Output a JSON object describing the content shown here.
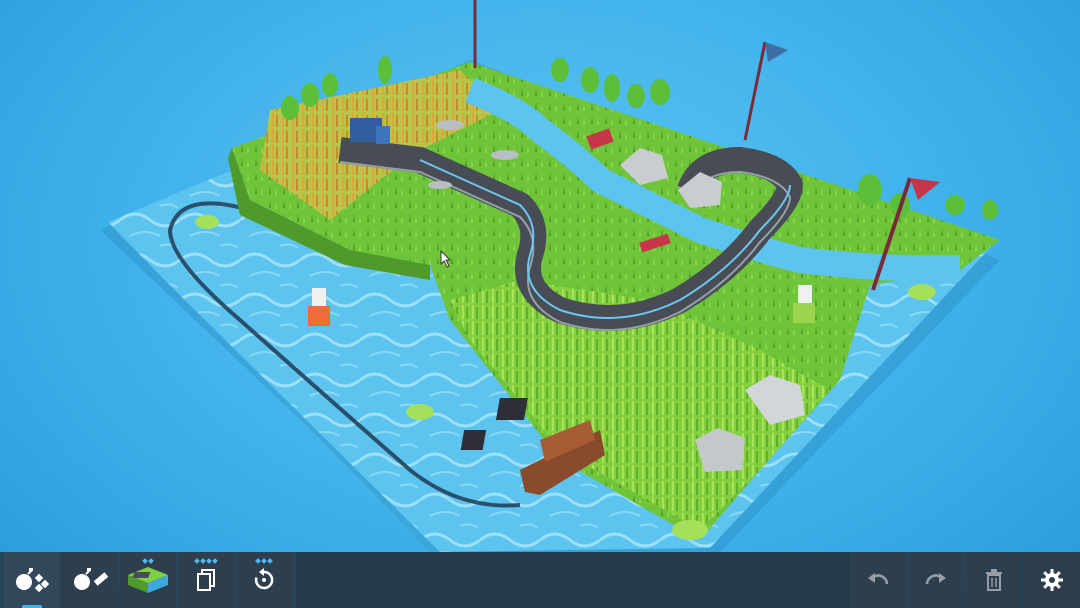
{
  "scene": {
    "description_icons": [
      "boat-icon",
      "truck-icon",
      "car-icon",
      "buoy-icon",
      "flag-icon"
    ],
    "colors": {
      "water": "#5cc3ee",
      "grass": "#7ccf3c",
      "road": "#474c55",
      "flag": "#c8344a",
      "boat_hull": "#8a4a2c"
    }
  },
  "toolbar": {
    "left_buttons": [
      {
        "icon": "bomb-tiles-icon",
        "active": true,
        "dots": 0
      },
      {
        "icon": "bomb-road-icon",
        "active": false,
        "dots": 0
      },
      {
        "icon": "terrain-block-icon",
        "active": false,
        "dots": 2
      },
      {
        "icon": "copy-icon",
        "active": false,
        "dots": 4
      },
      {
        "icon": "rotate-icon",
        "active": false,
        "dots": 3
      }
    ],
    "right_buttons": [
      {
        "icon": "undo-icon",
        "enabled": false
      },
      {
        "icon": "redo-icon",
        "enabled": false
      },
      {
        "icon": "trash-icon",
        "enabled": false
      },
      {
        "icon": "settings-gear-icon",
        "enabled": true
      }
    ]
  }
}
